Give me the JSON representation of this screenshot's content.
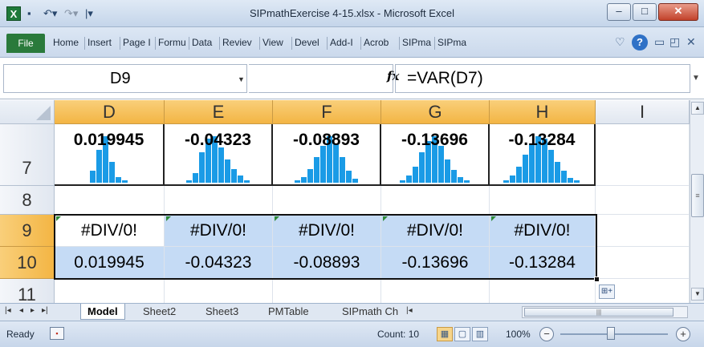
{
  "window": {
    "title": "SIPmathExercise 4-15.xlsx - Microsoft Excel",
    "app_icon": "excel-icon",
    "qat": [
      "save-icon",
      "undo-icon",
      "redo-icon",
      "customize-qat-icon"
    ]
  },
  "ribbon": {
    "file_label": "File",
    "tabs": [
      "Home",
      "Insert",
      "Page I",
      "Formu",
      "Data",
      "Reviev",
      "View",
      "Devel",
      "Add-I",
      "Acrob",
      "SIPma",
      "SIPma"
    ]
  },
  "formula_bar": {
    "name_box": "D9",
    "fx_label": "fx",
    "formula": "=VAR(D7)"
  },
  "grid": {
    "columns": [
      "D",
      "E",
      "F",
      "G",
      "H",
      "I"
    ],
    "rows": [
      "7",
      "8",
      "9",
      "10",
      "11"
    ],
    "row7_values": [
      "0.019945",
      "-0.04323",
      "-0.08893",
      "-0.13696",
      "-0.13284"
    ],
    "row9_values": [
      "#DIV/0!",
      "#DIV/0!",
      "#DIV/0!",
      "#DIV/0!",
      "#DIV/0!"
    ],
    "row10_values": [
      "0.019945",
      "-0.04323",
      "-0.08893",
      "-0.13696",
      "-0.13284"
    ],
    "sparkline_bars": [
      [
        0.25,
        0.7,
        1.0,
        0.45,
        0.12,
        0.05
      ],
      [
        0.05,
        0.2,
        0.65,
        0.95,
        1.0,
        0.75,
        0.5,
        0.3,
        0.15,
        0.05
      ],
      [
        0.05,
        0.12,
        0.3,
        0.55,
        0.8,
        1.0,
        0.85,
        0.55,
        0.25,
        0.08
      ],
      [
        0.05,
        0.15,
        0.35,
        0.65,
        0.9,
        1.0,
        0.8,
        0.5,
        0.28,
        0.12,
        0.05
      ],
      [
        0.05,
        0.15,
        0.35,
        0.6,
        0.85,
        1.0,
        0.95,
        0.7,
        0.45,
        0.25,
        0.1,
        0.05
      ]
    ],
    "selected_range": "D9:H10",
    "active_cell": "D9",
    "colors": {
      "bar": "#1a9be6",
      "selection": "#c5dbf5",
      "header_selected": "#f3b544"
    }
  },
  "sheets": {
    "tabs": [
      "Model",
      "Sheet2",
      "Sheet3",
      "PMTable",
      "SIPmath Ch"
    ],
    "active": "Model"
  },
  "status": {
    "ready": "Ready",
    "count": "Count: 10",
    "zoom": "100%",
    "zoom_minus": "−",
    "zoom_plus": "+"
  }
}
